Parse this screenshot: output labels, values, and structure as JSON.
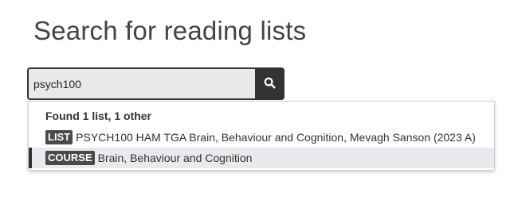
{
  "page": {
    "title": "Search for reading lists"
  },
  "search": {
    "value": "psych100",
    "button_icon": "search-icon"
  },
  "dropdown": {
    "summary": "Found 1 list, 1 other",
    "results": [
      {
        "type": "LIST",
        "text": "PSYCH100 HAM TGA Brain, Behaviour and Cognition, Mevagh Sanson (2023 A)",
        "highlighted": false
      },
      {
        "type": "COURSE",
        "text": "Brain, Behaviour and Cognition",
        "highlighted": true
      }
    ]
  },
  "colors": {
    "text": "#444444",
    "button": "#333333",
    "badge": "#4a4a4a",
    "highlight": "#e8eaee"
  }
}
